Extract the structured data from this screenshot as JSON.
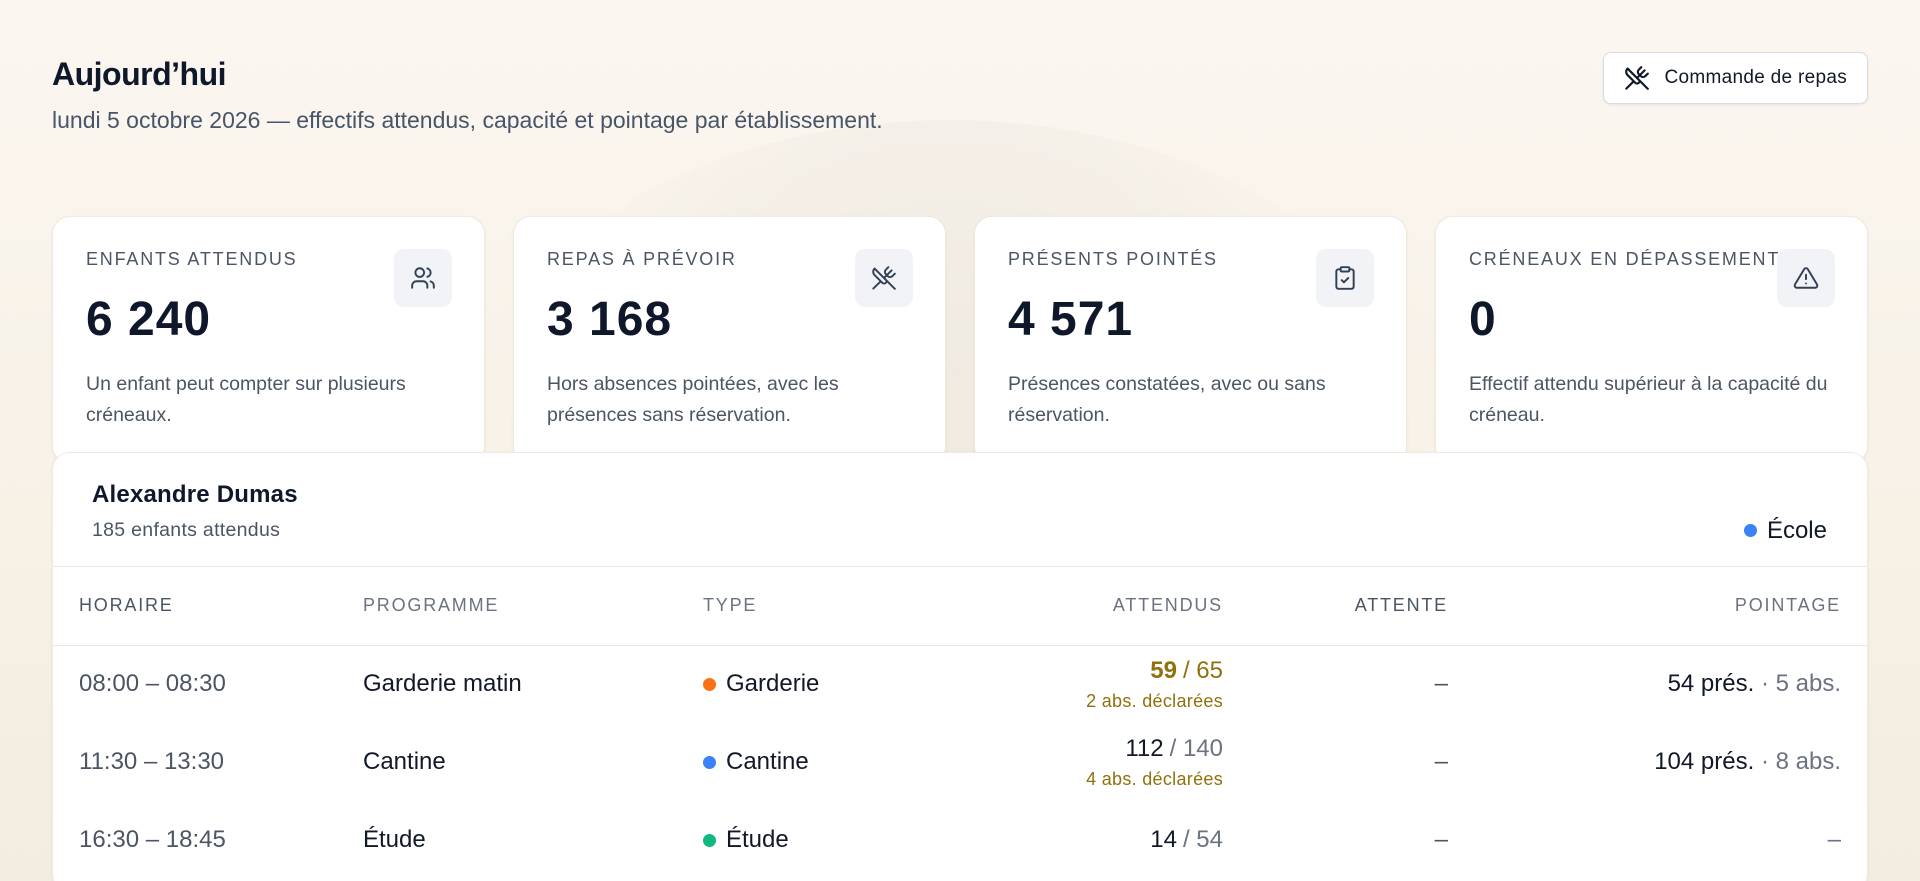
{
  "header": {
    "title": "Aujourd’hui",
    "subtitle": "lundi 5 octobre 2026 — effectifs attendus, capacité et pointage par établissement.",
    "meal_order_button": "Commande de repas"
  },
  "stats": [
    {
      "label": "Enfants attendus",
      "value": "6 240",
      "desc": "Un enfant peut compter sur plusieurs créneaux.",
      "icon": "users-icon"
    },
    {
      "label": "Repas à prévoir",
      "value": "3 168",
      "desc": "Hors absences pointées, avec les présences sans réservation.",
      "icon": "utensils-crossed-icon"
    },
    {
      "label": "Présents pointés",
      "value": "4 571",
      "desc": "Présences constatées, avec ou sans réservation.",
      "icon": "clipboard-check-icon"
    },
    {
      "label": "Créneaux en dépassement",
      "value": "0",
      "desc": "Effectif attendu supérieur à la capacité du créneau.",
      "icon": "warning-triangle-icon"
    }
  ],
  "school": {
    "name": "Alexandre Dumas",
    "subtitle": "185 enfants attendus",
    "type_label": "École",
    "type_color": "#3b82f6",
    "columns": [
      "Horaire",
      "Programme",
      "Type",
      "Attendus",
      "Attente",
      "Pointage"
    ],
    "rows": [
      {
        "time": "08:00 – 08:30",
        "program": "Garderie matin",
        "type": "Garderie",
        "type_color": "#f97316",
        "expected": "59",
        "capacity": "/ 65",
        "note": "2 abs. déclarées",
        "wait": "–",
        "present": "54 prés.",
        "absent": "· 5 abs.",
        "warn": true
      },
      {
        "time": "11:30 – 13:30",
        "program": "Cantine",
        "type": "Cantine",
        "type_color": "#3b82f6",
        "expected": "112",
        "capacity": "/ 140",
        "note": "4 abs. déclarées",
        "wait": "–",
        "present": "104 prés.",
        "absent": "· 8 abs.",
        "warn": false
      },
      {
        "time": "16:30 – 18:45",
        "program": "Étude",
        "type": "Étude",
        "type_color": "#10b981",
        "expected": "14",
        "capacity": "/ 54",
        "note": "",
        "wait": "–",
        "present": "",
        "absent": "–",
        "warn": false
      }
    ]
  }
}
